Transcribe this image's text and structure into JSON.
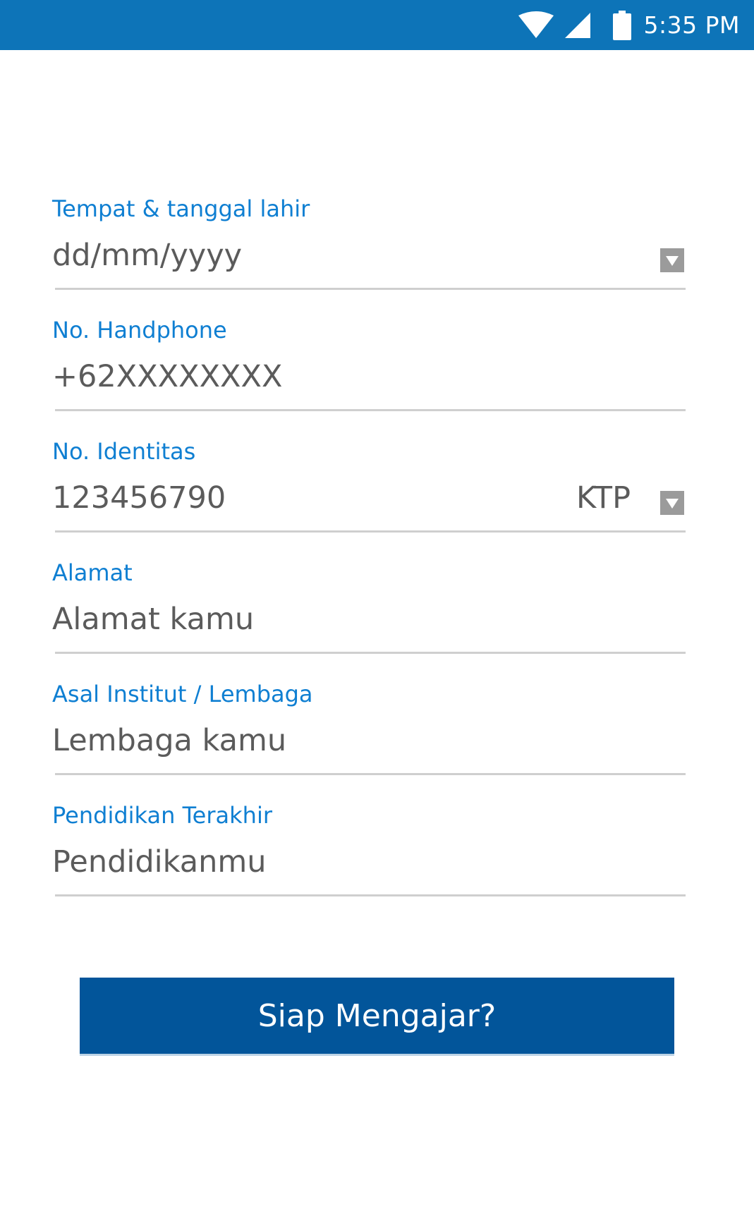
{
  "status_bar": {
    "time": "5:35 PM",
    "icons": [
      "wifi-icon",
      "signal-icon",
      "battery-icon"
    ],
    "background": "#0d74b8"
  },
  "form": {
    "fields": [
      {
        "label": "Tempat & tanggal lahir",
        "value": "dd/mm/yyyy",
        "has_dropdown": true
      },
      {
        "label": "No. Handphone",
        "value": "+62XXXXXXXX",
        "has_dropdown": false
      },
      {
        "label": "No. Identitas",
        "value": "123456790",
        "type_value": "KTP",
        "has_dropdown": true
      },
      {
        "label": "Alamat",
        "value": "Alamat kamu",
        "has_dropdown": false
      },
      {
        "label": "Asal Institut / Lembaga",
        "value": "Lembaga kamu",
        "has_dropdown": false
      },
      {
        "label": "Pendidikan Terakhir",
        "value": "Pendidikanmu",
        "has_dropdown": false
      }
    ],
    "label_color": "#0f7fd2",
    "value_color": "#5b5b5b"
  },
  "submit": {
    "label": "Siap Mengajar?",
    "background": "#02559a"
  }
}
